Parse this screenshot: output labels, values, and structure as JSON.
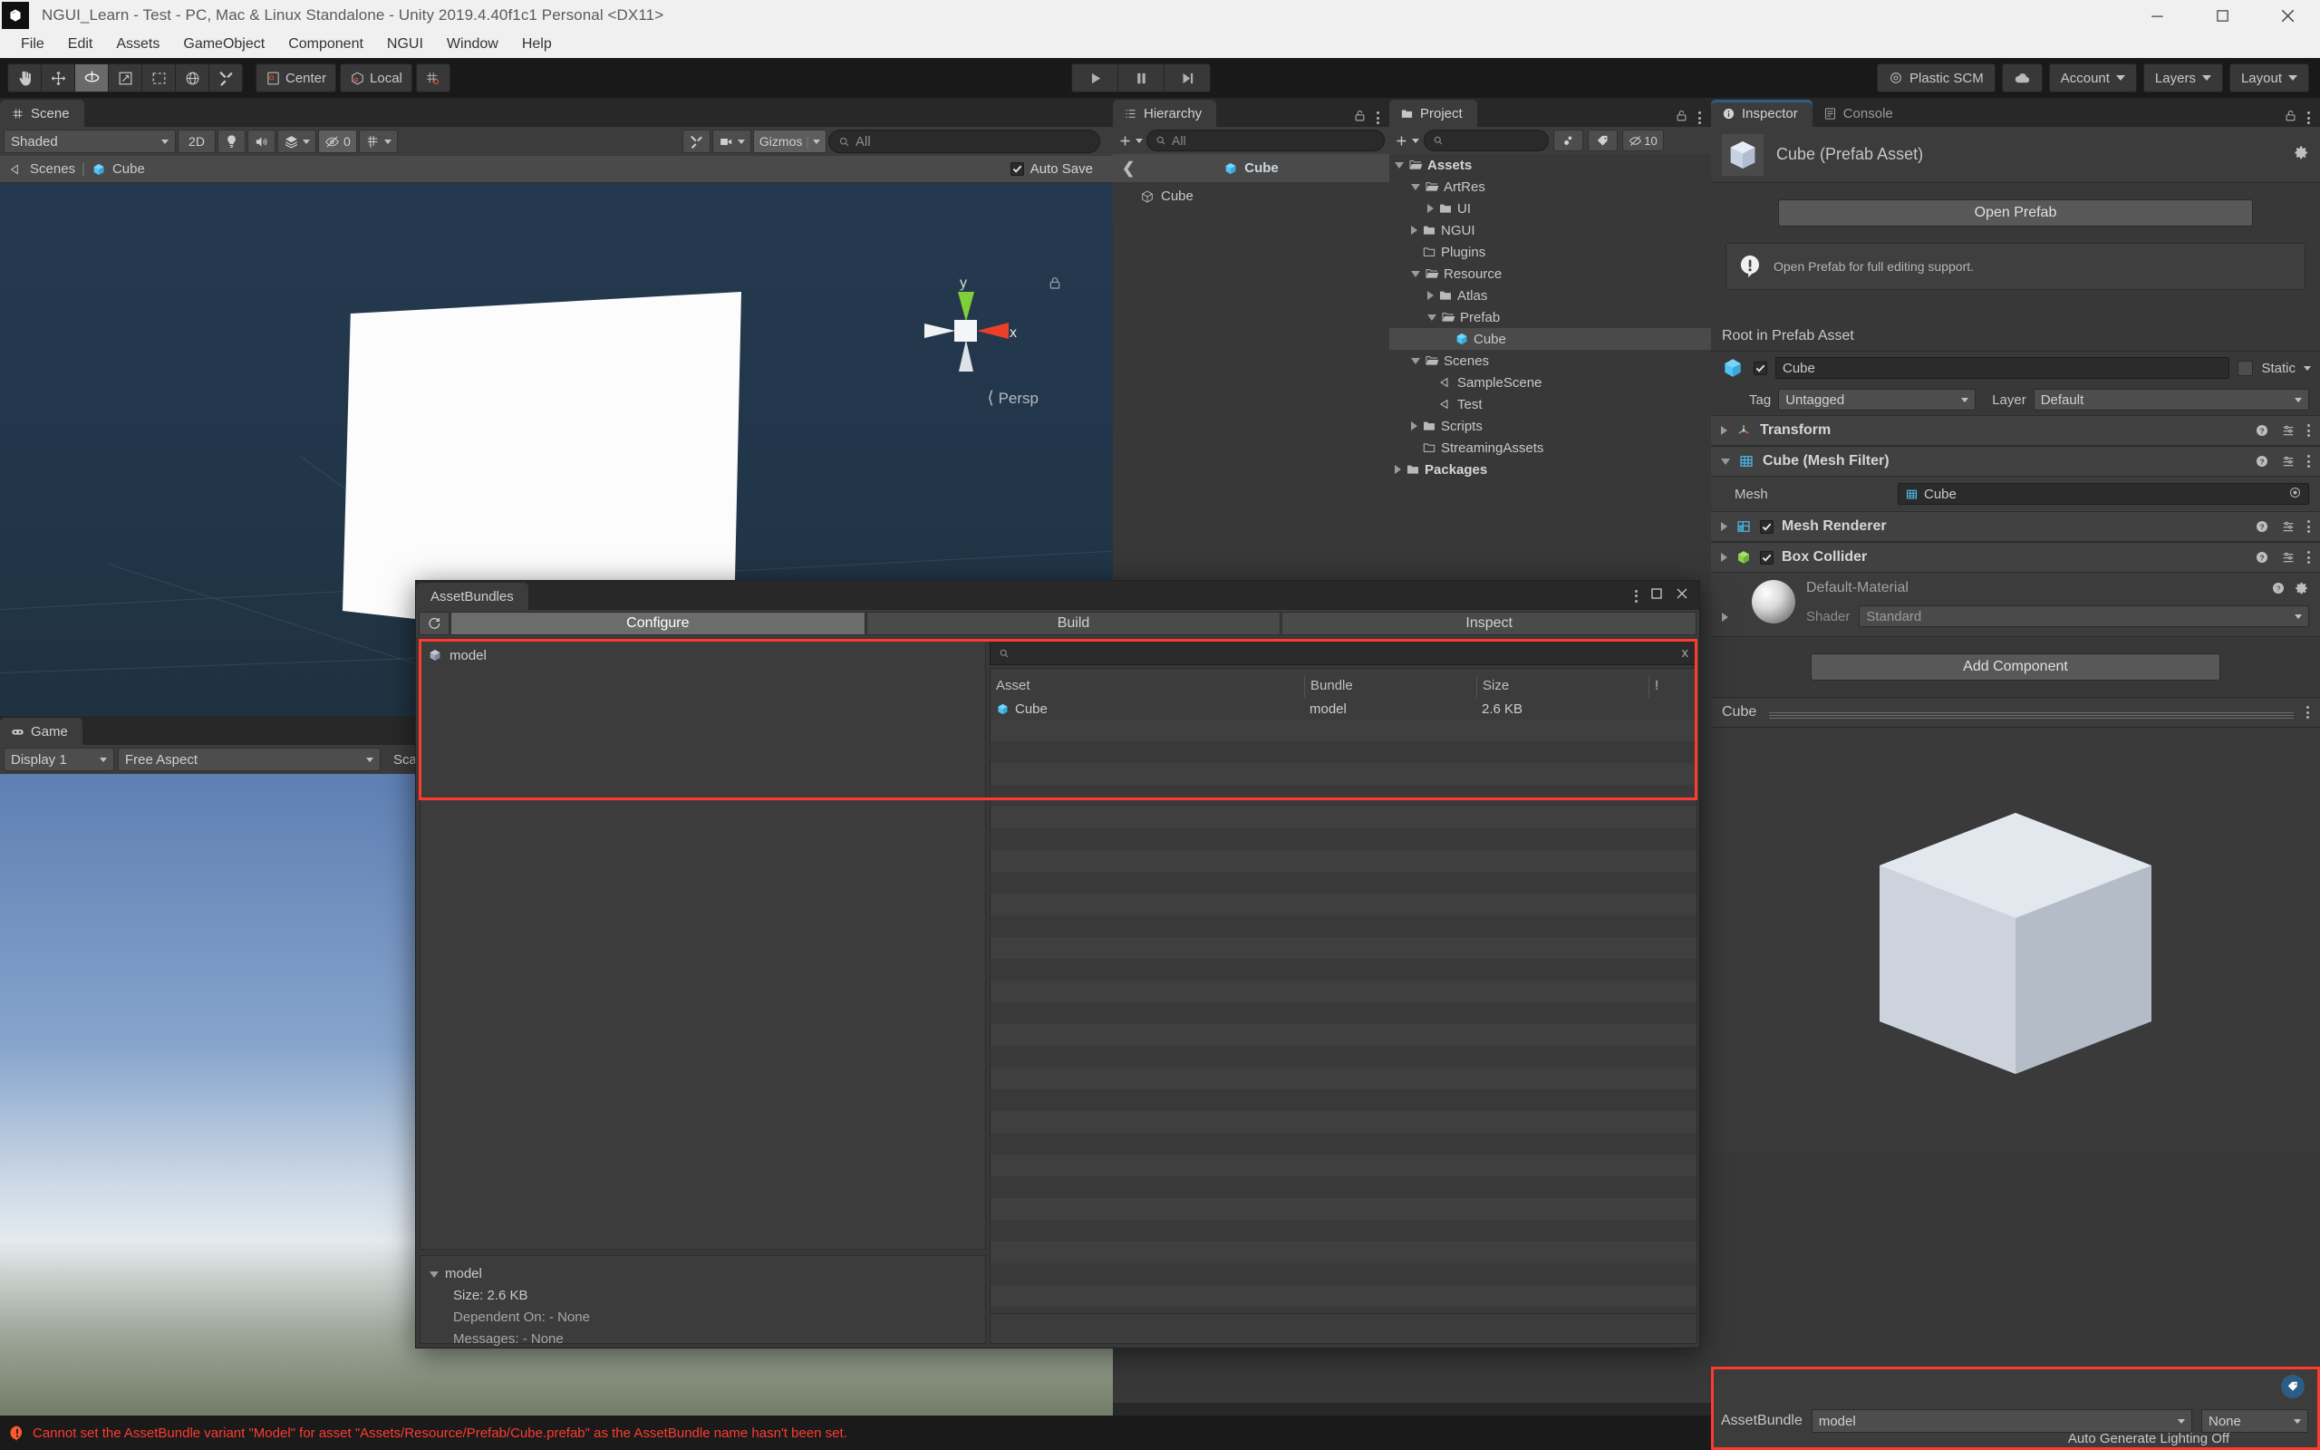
{
  "window": {
    "title": "NGUI_Learn - Test - PC, Mac & Linux Standalone - Unity 2019.4.40f1c1 Personal <DX11>",
    "controls": {
      "minimize": "minimize-icon",
      "maximize": "maximize-icon",
      "close": "close-icon"
    }
  },
  "menubar": {
    "items": [
      "File",
      "Edit",
      "Assets",
      "GameObject",
      "Component",
      "NGUI",
      "Window",
      "Help"
    ]
  },
  "toolbar": {
    "tools": [
      "hand-tool",
      "move-tool",
      "rotate-tool",
      "scale-tool",
      "rect-tool",
      "transform-tool",
      "custom-tool"
    ],
    "active_tool_index": 2,
    "pivot_mode": "Center",
    "handle_space": "Local",
    "snap_label": "grid-snap-icon",
    "play": "play-button",
    "pause": "pause-button",
    "step": "step-button",
    "plastic_scm": "Plastic SCM",
    "cloud": "cloud-icon",
    "account": "Account",
    "layers": "Layers",
    "layout": "Layout"
  },
  "scene": {
    "tab": "Scene",
    "shading_mode": "Shaded",
    "mode_2d": "2D",
    "lighting_icon": "lighting-icon",
    "audio_icon": "audio-icon",
    "fx_icon": "effects-icon",
    "hidden_objects_count": "0",
    "grid_icon": "grid-visibility-icon",
    "tools_icon": "scene-tools-icon",
    "camera_icon": "scene-camera-icon",
    "gizmos": "Gizmos",
    "search_placeholder": "All",
    "breadcrumb": [
      "Scenes",
      "Cube"
    ],
    "auto_save_label": "Auto Save",
    "auto_save_checked": true,
    "gizmo_axis_x": "x",
    "gizmo_axis_y": "y",
    "projection": "Persp",
    "lock_icon": "lock-icon"
  },
  "game": {
    "tab": "Game",
    "display": "Display 1",
    "aspect": "Free Aspect",
    "scale_label": "Scale"
  },
  "hierarchy": {
    "tab": "Hierarchy",
    "search_placeholder": "All",
    "prefab_root": "Cube",
    "items": [
      {
        "label": "Cube",
        "icon": "prefab-cube-icon",
        "indent": 1
      }
    ]
  },
  "project": {
    "tab": "Project",
    "search_placeholder": "",
    "favorite_icon": "favorites-icon",
    "tag_icon": "label-icon",
    "hidden_count": "10",
    "tree": [
      {
        "label": "Assets",
        "indent": 0,
        "arrow": "down",
        "icon": "folder-open-icon",
        "bold": true
      },
      {
        "label": "ArtRes",
        "indent": 1,
        "arrow": "down",
        "icon": "folder-open-icon"
      },
      {
        "label": "UI",
        "indent": 2,
        "arrow": "right",
        "icon": "folder-icon"
      },
      {
        "label": "NGUI",
        "indent": 1,
        "arrow": "right",
        "icon": "folder-icon"
      },
      {
        "label": "Plugins",
        "indent": 1,
        "arrow": "none",
        "icon": "folder-empty-icon"
      },
      {
        "label": "Resource",
        "indent": 1,
        "arrow": "down",
        "icon": "folder-open-icon"
      },
      {
        "label": "Atlas",
        "indent": 2,
        "arrow": "right",
        "icon": "folder-icon"
      },
      {
        "label": "Prefab",
        "indent": 2,
        "arrow": "down",
        "icon": "folder-open-icon"
      },
      {
        "label": "Cube",
        "indent": 3,
        "arrow": "none",
        "icon": "prefab-cube-icon",
        "selected": true
      },
      {
        "label": "Scenes",
        "indent": 1,
        "arrow": "down",
        "icon": "folder-open-icon"
      },
      {
        "label": "SampleScene",
        "indent": 2,
        "arrow": "none",
        "icon": "unity-scene-icon"
      },
      {
        "label": "Test",
        "indent": 2,
        "arrow": "none",
        "icon": "unity-scene-icon"
      },
      {
        "label": "Scripts",
        "indent": 1,
        "arrow": "right",
        "icon": "folder-icon"
      },
      {
        "label": "StreamingAssets",
        "indent": 1,
        "arrow": "none",
        "icon": "folder-empty-icon"
      },
      {
        "label": "Packages",
        "indent": 0,
        "arrow": "right",
        "icon": "folder-icon",
        "bold": true
      }
    ]
  },
  "inspector": {
    "tabs": [
      {
        "label": "Inspector",
        "icon": "info-icon",
        "active": true
      },
      {
        "label": "Console",
        "icon": "console-icon",
        "active": false
      }
    ],
    "asset_title": "Cube (Prefab Asset)",
    "asset_icon": "cube-preview-icon",
    "gear_icon": "gear-icon",
    "open_prefab_label": "Open Prefab",
    "hint_text": "Open Prefab for full editing support.",
    "hint_icon": "warning-icon",
    "root_label": "Root in Prefab Asset",
    "object_name": "Cube",
    "object_enabled": true,
    "static_label": "Static",
    "tag_label": "Tag",
    "tag_value": "Untagged",
    "layer_label": "Layer",
    "layer_value": "Default",
    "components": [
      {
        "name": "Transform",
        "icon": "transform-icon",
        "expanded": false,
        "has_toggle": false
      },
      {
        "name": "Cube (Mesh Filter)",
        "icon": "mesh-filter-icon",
        "expanded": true,
        "has_toggle": false
      },
      {
        "name": "Mesh Renderer",
        "icon": "mesh-renderer-icon",
        "expanded": false,
        "has_toggle": true,
        "enabled": true
      },
      {
        "name": "Box Collider",
        "icon": "box-collider-icon",
        "expanded": false,
        "has_toggle": true,
        "enabled": true
      }
    ],
    "mesh_field_label": "Mesh",
    "mesh_field_value": "Cube",
    "material_name": "Default-Material",
    "shader_label": "Shader",
    "shader_value": "Standard",
    "add_component_label": "Add Component",
    "preview_title": "Cube",
    "assetbundle_label": "AssetBundle",
    "assetbundle_value": "model",
    "assetbundle_variant": "None",
    "assetbundle_tag_icon": "asset-label-icon"
  },
  "assetbundles_window": {
    "title": "AssetBundles",
    "kebab_icon": "options-icon",
    "dock_icon": "maximize-window-icon",
    "close_icon": "close-window-icon",
    "refresh_icon": "refresh-icon",
    "tabs": [
      {
        "label": "Configure",
        "active": true
      },
      {
        "label": "Build",
        "active": false
      },
      {
        "label": "Inspect",
        "active": false
      }
    ],
    "bundle_list": [
      {
        "label": "model",
        "icon": "bundle-icon"
      }
    ],
    "search_placeholder": "",
    "search_clear": "x",
    "columns": [
      "Asset",
      "Bundle",
      "Size",
      "!"
    ],
    "rows": [
      {
        "asset": "Cube",
        "bundle": "model",
        "size": "2.6 KB",
        "flag": "",
        "icon": "prefab-cube-icon"
      }
    ],
    "details": {
      "bundle_name": "model",
      "size": "Size: 2.6 KB",
      "dependent_on": "Dependent On: - None",
      "messages": "Messages: - None"
    }
  },
  "statusbar": {
    "icon": "error-icon",
    "message": "Cannot set the AssetBundle variant \"Model\" for asset \"Assets/Resource/Prefab/Cube.prefab\" as the AssetBundle name hasn't been set.",
    "auto_generate_lighting": "Auto Generate Lighting Off"
  },
  "colors": {
    "accent_red": "#ff3b30",
    "accent_blue": "#4fc3f7",
    "panel_bg": "#383838",
    "toolbar_bg": "#3c3c3c",
    "selection": "#4a4a4a"
  }
}
